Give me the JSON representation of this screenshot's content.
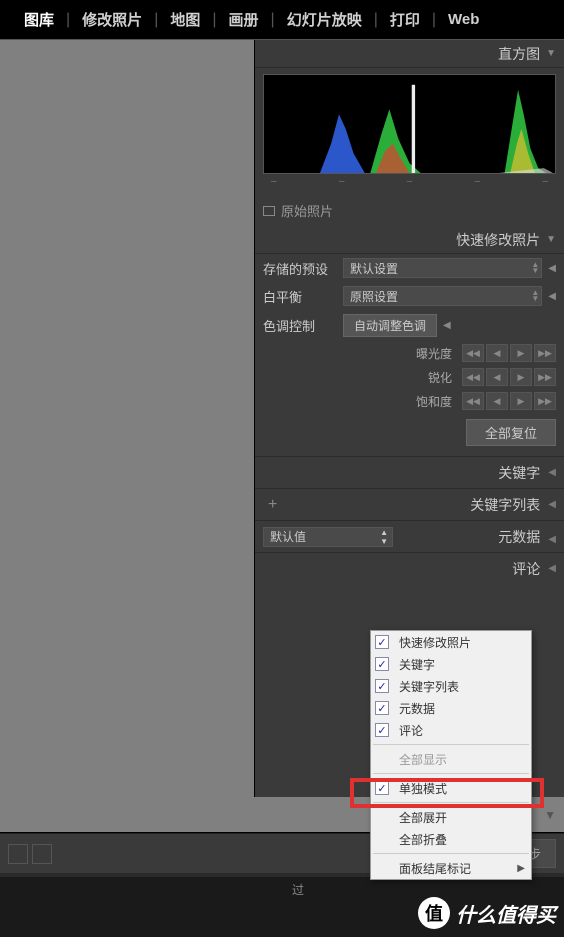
{
  "nav": {
    "items": [
      "图库",
      "修改照片",
      "地图",
      "画册",
      "幻灯片放映",
      "打印",
      "Web"
    ],
    "active_index": 0
  },
  "panels": {
    "histogram": {
      "title": "直方图",
      "original_label": "原始照片"
    },
    "quick_dev": {
      "title": "快速修改照片",
      "preset_label": "存储的预设",
      "preset_value": "默认设置",
      "wb_label": "白平衡",
      "wb_value": "原照设置",
      "tone_label": "色调控制",
      "auto_tone": "自动调整色调",
      "exposure": "曝光度",
      "sharpen": "锐化",
      "saturation": "饱和度",
      "reset": "全部复位"
    },
    "keywords": {
      "title": "关键字"
    },
    "keyword_list": {
      "title": "关键字列表"
    },
    "metadata": {
      "title": "元数据",
      "select_value": "默认值"
    },
    "comments": {
      "title": "评论"
    }
  },
  "toolbar": {
    "sync": "同步",
    "filter": "过"
  },
  "context_menu": {
    "items": [
      {
        "label": "快速修改照片",
        "checked": true
      },
      {
        "label": "关键字",
        "checked": true
      },
      {
        "label": "关键字列表",
        "checked": true
      },
      {
        "label": "元数据",
        "checked": true
      },
      {
        "label": "评论",
        "checked": true
      }
    ],
    "show_all": "全部显示",
    "solo_mode": "单独模式",
    "expand_all": "全部展开",
    "collapse_all": "全部折叠",
    "end_marker": "面板结尾标记"
  },
  "watermark": "什么值得买"
}
